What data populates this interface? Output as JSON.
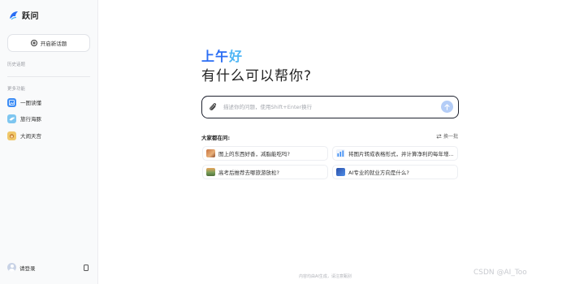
{
  "app": {
    "name": "跃问"
  },
  "sidebar": {
    "new_topic_label": "开启新话题",
    "history_label": "历史话题",
    "more_label": "更多功能",
    "items": [
      {
        "label": "一图读懂",
        "icon": "image-doc-icon",
        "color": "#3b8cf5"
      },
      {
        "label": "旅行海豚",
        "icon": "dolphin-icon",
        "color": "#7ec6f0"
      },
      {
        "label": "大闹天宫",
        "icon": "monkey-king-icon",
        "color": "#f0c86b"
      }
    ],
    "login_label": "请登录"
  },
  "main": {
    "greeting_part1": "上午",
    "greeting_part2": "好",
    "headline": "有什么可以帮你?",
    "input": {
      "placeholder": "描述你的问题，使用Shift+Enter换行",
      "value": ""
    },
    "suggestions_label": "大家都在问:",
    "refresh_label": "换一批",
    "suggestions": [
      {
        "text": "图上的东西好香，减脂能吃吗?",
        "thumb": "food-thumb"
      },
      {
        "text": "将图片转成表格形式，并计算净利的每年增...",
        "thumb": "chart-thumb"
      },
      {
        "text": "高考后推荐去哪旅游放松?",
        "thumb": "landscape-thumb"
      },
      {
        "text": "AI专业的就业方向是什么?",
        "thumb": "ai-thumb"
      }
    ],
    "footer_note": "内容均由AI生成，请注意甄别"
  },
  "watermark": "CSDN @AI_Too",
  "colors": {
    "accent": "#2a6df4",
    "accent_light": "#4fb6f5",
    "send_disabled": "#b4cdf7",
    "sidebar_bg": "#f9fafb"
  }
}
